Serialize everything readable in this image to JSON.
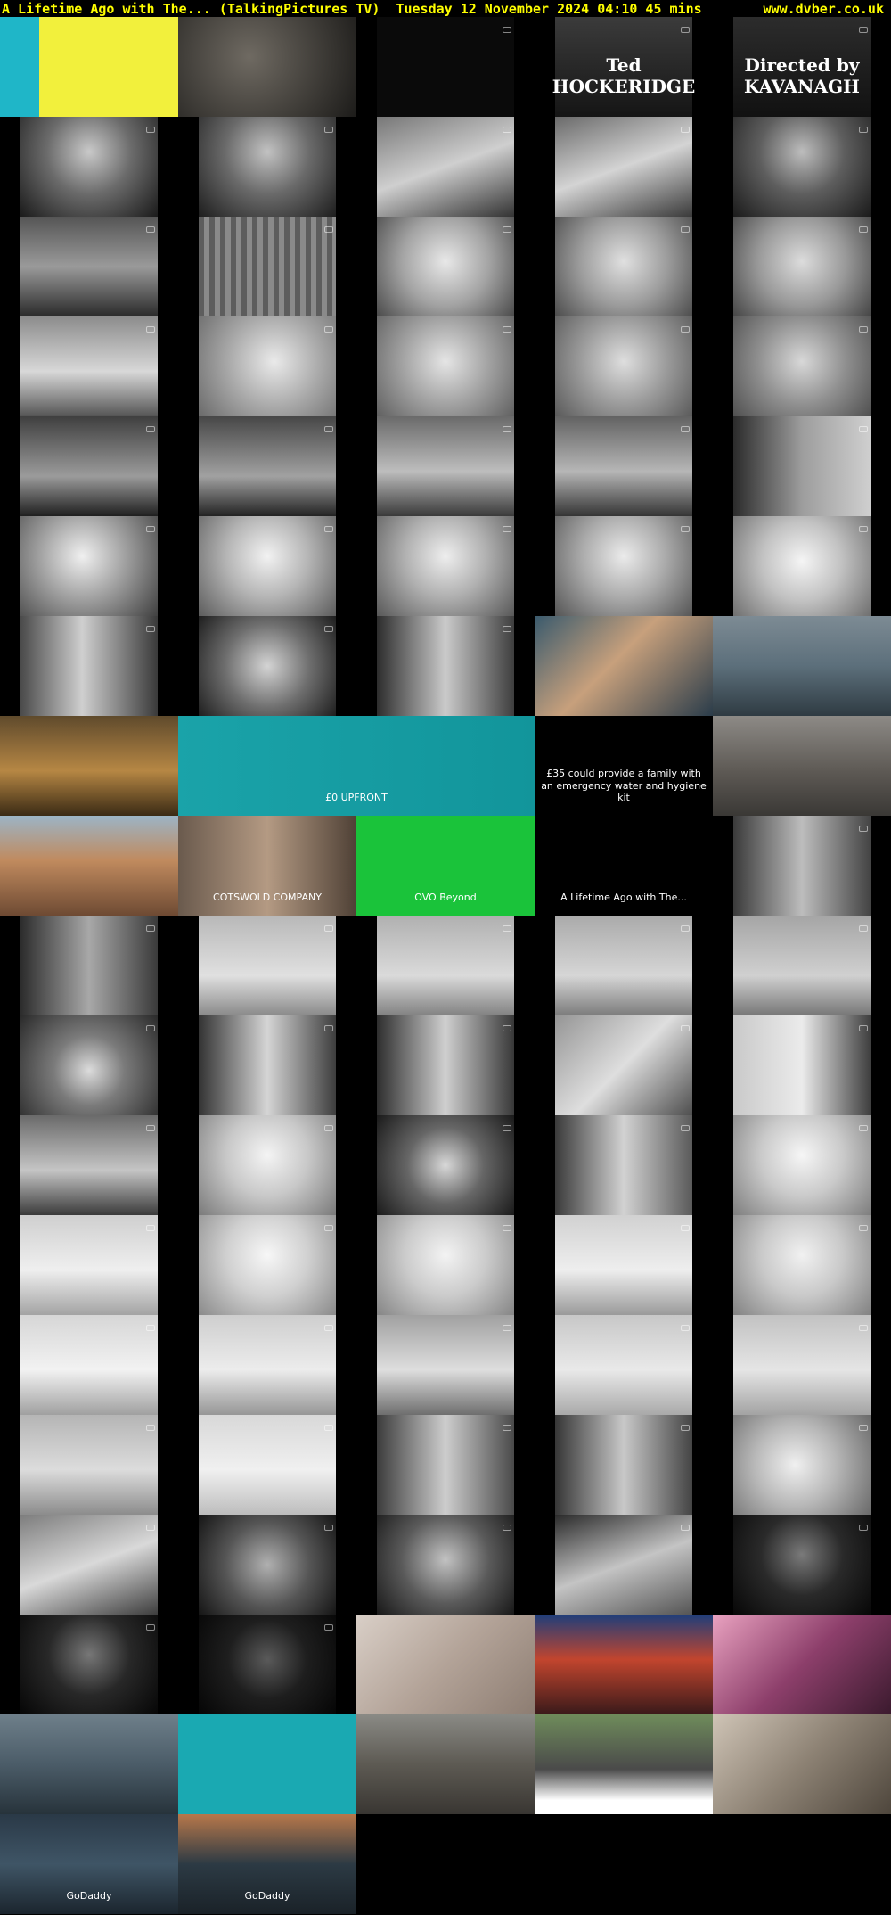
{
  "header": {
    "title": "A Lifetime Ago with The... (TalkingPictures TV)",
    "date": "Tuesday 12 November 2024",
    "time": "04:10",
    "duration": "45 mins",
    "site": "www.dvber.co.uk",
    "text_color": "#ffff00",
    "background": "#000000"
  },
  "rows": [
    [
      {
        "name": "thumb-advert-yellow",
        "kind": "colour",
        "bg": "linear-gradient(90deg,#1fb6c8 0%,#1fb6c8 22%,#f2f03c 22%,#f2f03c 100%)",
        "caption": ""
      },
      {
        "name": "thumb-dark-frame",
        "kind": "colour",
        "bg": "radial-gradient(circle at 40% 40%,#6f6a62,#1c1b19)",
        "caption": ""
      },
      {
        "name": "thumb-black-frame",
        "kind": "bw",
        "bg": "#0a0a0a",
        "caption": ""
      },
      {
        "name": "thumb-credit-hockeridge",
        "kind": "bw",
        "bg": "linear-gradient(180deg,#3b3b3b,#151515)",
        "caption": "Ted HOCKERIDGE",
        "big": true
      },
      {
        "name": "thumb-credit-kavanagh",
        "kind": "bw",
        "bg": "linear-gradient(180deg,#2c2c2c,#111)",
        "caption": "Directed by KAVANAGH",
        "big": true
      }
    ],
    [
      {
        "name": "thumb-man-portrait",
        "kind": "bw",
        "bg": "radial-gradient(circle at 50% 35%,#c9c9c9,#6b6b6b 45%,#1a1a1a)",
        "caption": ""
      },
      {
        "name": "thumb-man-portrait-2",
        "kind": "bw",
        "bg": "radial-gradient(circle at 50% 35%,#c2c2c2,#6a6a6a 45%,#1d1d1d)",
        "caption": ""
      },
      {
        "name": "thumb-piano-hands",
        "kind": "bw",
        "bg": "linear-gradient(160deg,#777,#cfcfcf 50%,#333)",
        "caption": ""
      },
      {
        "name": "thumb-piano-hands-2",
        "kind": "bw",
        "bg": "linear-gradient(160deg,#6a6a6a,#d4d4d4 50%,#3a3a3a)",
        "caption": ""
      },
      {
        "name": "thumb-man-portrait-3",
        "kind": "bw",
        "bg": "radial-gradient(circle at 50% 35%,#bdbdbd,#5e5e5e 45%,#1b1b1b)",
        "caption": ""
      }
    ],
    [
      {
        "name": "thumb-group-scene",
        "kind": "bw",
        "bg": "linear-gradient(180deg,#555,#9a9a9a 50%,#2a2a2a)",
        "caption": ""
      },
      {
        "name": "thumb-curtain",
        "kind": "bw",
        "bg": "repeating-linear-gradient(90deg,#5d5d5d 0 6px,#8a8a8a 6px 12px)",
        "caption": ""
      },
      {
        "name": "thumb-top-hat-singer",
        "kind": "bw",
        "bg": "radial-gradient(circle at 50% 45%,#e8e8e8,#a3a3a3 50%,#4a4a4a)",
        "caption": ""
      },
      {
        "name": "thumb-top-hat-singer-2",
        "kind": "bw",
        "bg": "radial-gradient(circle at 50% 45%,#e0e0e0,#9c9c9c 50%,#4c4c4c)",
        "caption": ""
      },
      {
        "name": "thumb-top-hat-singer-3",
        "kind": "bw",
        "bg": "radial-gradient(circle at 50% 45%,#dcdcdc,#999 50%,#454545)",
        "caption": ""
      }
    ],
    [
      {
        "name": "thumb-singer-wide",
        "kind": "bw",
        "bg": "linear-gradient(180deg,#8c8c8c,#d8d8d8 55%,#555)",
        "caption": ""
      },
      {
        "name": "thumb-singer-closeup",
        "kind": "bw",
        "bg": "radial-gradient(circle at 55% 45%,#eaeaea,#a8a8a8 50%,#6a6a6a)",
        "caption": ""
      },
      {
        "name": "thumb-singer-closeup-2",
        "kind": "bw",
        "bg": "radial-gradient(circle at 50% 45%,#e5e5e5,#a1a1a1 50%,#606060)",
        "caption": ""
      },
      {
        "name": "thumb-singer-closeup-3",
        "kind": "bw",
        "bg": "radial-gradient(circle at 50% 45%,#dedede,#9a9a9a 50%,#5a5a5a)",
        "caption": ""
      },
      {
        "name": "thumb-singer-closeup-4",
        "kind": "bw",
        "bg": "radial-gradient(circle at 50% 45%,#d8d8d8,#8f8f8f 50%,#505050)",
        "caption": ""
      }
    ],
    [
      {
        "name": "thumb-singer-stage",
        "kind": "bw",
        "bg": "linear-gradient(180deg,#3f3f3f,#9b9b9b 60%,#1f1f1f)",
        "caption": ""
      },
      {
        "name": "thumb-singer-stage-2",
        "kind": "bw",
        "bg": "linear-gradient(180deg,#474747,#a1a1a1 60%,#232323)",
        "caption": ""
      },
      {
        "name": "thumb-piano-stage",
        "kind": "bw",
        "bg": "linear-gradient(180deg,#6a6a6a,#bdbdbd 55%,#3a3a3a)",
        "caption": ""
      },
      {
        "name": "thumb-piano-stage-2",
        "kind": "bw",
        "bg": "linear-gradient(180deg,#626262,#b6b6b6 55%,#353535)",
        "caption": ""
      },
      {
        "name": "thumb-couple-curtain",
        "kind": "bw",
        "bg": "linear-gradient(90deg,#2b2b2b,#9d9d9d 50%,#cfcfcf)",
        "caption": ""
      }
    ],
    [
      {
        "name": "thumb-woman-profile",
        "kind": "bw",
        "bg": "radial-gradient(circle at 45% 40%,#f0f0f0,#a0a0a0 45%,#404040)",
        "caption": ""
      },
      {
        "name": "thumb-woman-portrait",
        "kind": "bw",
        "bg": "radial-gradient(circle at 50% 40%,#f2f2f2,#b5b5b5 45%,#5c5c5c)",
        "caption": ""
      },
      {
        "name": "thumb-woman-portrait-2",
        "kind": "bw",
        "bg": "radial-gradient(circle at 50% 40%,#eeeeee,#b0b0b0 45%,#585858)",
        "caption": ""
      },
      {
        "name": "thumb-woman-portrait-3",
        "kind": "bw",
        "bg": "radial-gradient(circle at 50% 40%,#ebebeb,#acacac 45%,#555)",
        "caption": ""
      },
      {
        "name": "thumb-woman-closeup",
        "kind": "bw",
        "bg": "radial-gradient(circle at 50% 45%,#f5f5f5,#c2c2c2 45%,#6f6f6f)",
        "caption": ""
      }
    ],
    [
      {
        "name": "thumb-couple",
        "kind": "bw",
        "bg": "linear-gradient(90deg,#4a4a4a,#cfcfcf 45%,#3a3a3a)",
        "caption": ""
      },
      {
        "name": "thumb-large-man",
        "kind": "bw",
        "bg": "radial-gradient(circle at 50% 50%,#d4d4d4,#6e6e6e 50%,#1e1e1e)",
        "caption": ""
      },
      {
        "name": "thumb-two-men",
        "kind": "bw",
        "bg": "linear-gradient(90deg,#2d2d2d,#cacaca 50%,#3e3e3e)",
        "caption": ""
      },
      {
        "name": "thumb-advert-young-man",
        "kind": "colour",
        "bg": "linear-gradient(135deg,#3a5a6d,#c7a07c 45%,#2a3c4a)",
        "caption": ""
      },
      {
        "name": "thumb-advert-boxer",
        "kind": "colour",
        "bg": "linear-gradient(180deg,#7d8b94,#5c6f7b 50%,#2f3b43)",
        "caption": ""
      }
    ],
    [
      {
        "name": "thumb-advert-lion",
        "kind": "colour",
        "bg": "linear-gradient(180deg,#5f4a2c,#b68744 55%,#3a2a14)",
        "caption": ""
      },
      {
        "name": "thumb-advert-ee-broadband",
        "kind": "colour",
        "bg": "linear-gradient(90deg,#1aa3a9,#12959b)",
        "caption": "£0 UPFRONT",
        "wide": true
      },
      {
        "name": "thumb-advert-appeal",
        "kind": "colour",
        "bg": "#000000",
        "caption": "£35 could provide a family with an emergency water and hygiene kit"
      },
      {
        "name": "thumb-advert-rubble",
        "kind": "colour",
        "bg": "linear-gradient(180deg,#8d8a86,#5e5a55 55%,#3a3835)",
        "caption": ""
      }
    ],
    [
      {
        "name": "thumb-advert-city",
        "kind": "colour",
        "bg": "linear-gradient(180deg,#9cb4c5,#c08a5e 45%,#6e4a33)",
        "caption": ""
      },
      {
        "name": "thumb-advert-cotswold",
        "kind": "colour",
        "bg": "linear-gradient(90deg,#6a5a4d,#b49a83 50%,#4f4136)",
        "caption": "COTSWOLD COMPANY"
      },
      {
        "name": "thumb-advert-ovo",
        "kind": "colour",
        "bg": "#1ac33a",
        "caption": "OVO Beyond"
      },
      {
        "name": "thumb-channel-ident",
        "kind": "colour",
        "bg": "#000000",
        "caption": "A Lifetime Ago with The..."
      },
      {
        "name": "thumb-couple-dance",
        "kind": "bw",
        "bg": "linear-gradient(90deg,#3a3a3a,#bdbdbd 50%,#444)",
        "caption": ""
      }
    ],
    [
      {
        "name": "thumb-couple-embrace",
        "kind": "bw",
        "bg": "linear-gradient(90deg,#2c2c2c,#a8a8a8 50%,#3a3a3a)",
        "caption": ""
      },
      {
        "name": "thumb-dancers",
        "kind": "bw",
        "bg": "linear-gradient(180deg,#b8b8b8,#e0e0e0 60%,#8a8a8a)",
        "caption": ""
      },
      {
        "name": "thumb-dancers-2",
        "kind": "bw",
        "bg": "linear-gradient(180deg,#b0b0b0,#dadada 60%,#828282)",
        "caption": ""
      },
      {
        "name": "thumb-dancers-3",
        "kind": "bw",
        "bg": "linear-gradient(180deg,#aaaaaa,#d6d6d6 60%,#7c7c7c)",
        "caption": ""
      },
      {
        "name": "thumb-dancers-4",
        "kind": "bw",
        "bg": "linear-gradient(180deg,#a5a5a5,#d0d0d0 60%,#777)",
        "caption": ""
      }
    ],
    [
      {
        "name": "thumb-crystal-ball",
        "kind": "bw",
        "bg": "radial-gradient(circle at 50% 55%,#dcdcdc,#7b7b7b 40%,#2a2a2a)",
        "caption": ""
      },
      {
        "name": "thumb-stage-trio",
        "kind": "bw",
        "bg": "linear-gradient(90deg,#333,#d5d5d5 50%,#3d3d3d)",
        "caption": ""
      },
      {
        "name": "thumb-stage-trio-2",
        "kind": "bw",
        "bg": "linear-gradient(90deg,#2e2e2e,#cfcfcf 50%,#383838)",
        "caption": ""
      },
      {
        "name": "thumb-pianist-woman",
        "kind": "bw",
        "bg": "linear-gradient(135deg,#959595,#dedede 50%,#4e4e4e)",
        "caption": ""
      },
      {
        "name": "thumb-violinist-woman",
        "kind": "bw",
        "bg": "linear-gradient(90deg,#c9c9c9,#ebebeb 50%,#3f3f3f)",
        "caption": ""
      }
    ],
    [
      {
        "name": "thumb-band",
        "kind": "bw",
        "bg": "linear-gradient(180deg,#6a6a6a,#c5c5c5 55%,#3b3b3b)",
        "caption": ""
      },
      {
        "name": "thumb-woman-singing",
        "kind": "bw",
        "bg": "radial-gradient(circle at 50% 40%,#f4f4f4,#c8c8c8 45%,#7a7a7a)",
        "caption": ""
      },
      {
        "name": "thumb-guitarist",
        "kind": "bw",
        "bg": "radial-gradient(circle at 50% 50%,#d8d8d8,#666 45%,#1a1a1a)",
        "caption": ""
      },
      {
        "name": "thumb-woman-with-band",
        "kind": "bw",
        "bg": "linear-gradient(90deg,#3a3a3a,#d2d2d2 50%,#5a5a5a)",
        "caption": ""
      },
      {
        "name": "thumb-woman-smiling",
        "kind": "bw",
        "bg": "radial-gradient(circle at 50% 40%,#f6f6f6,#cacaca 45%,#7e7e7e)",
        "caption": ""
      }
    ],
    [
      {
        "name": "thumb-explorer",
        "kind": "bw",
        "bg": "linear-gradient(180deg,#cfcfcf,#efefef 55%,#a3a3a3)",
        "caption": ""
      },
      {
        "name": "thumb-explorer-closeup",
        "kind": "bw",
        "bg": "radial-gradient(circle at 50% 40%,#f7f7f7,#d0d0d0 45%,#8a8a8a)",
        "caption": ""
      },
      {
        "name": "thumb-explorer-2",
        "kind": "bw",
        "bg": "radial-gradient(circle at 50% 40%,#f3f3f3,#cbcbcb 45%,#858585)",
        "caption": ""
      },
      {
        "name": "thumb-explorer-globe",
        "kind": "bw",
        "bg": "linear-gradient(180deg,#d1d1d1,#eeeeee 55%,#9a9a9a)",
        "caption": ""
      },
      {
        "name": "thumb-explorer-3",
        "kind": "bw",
        "bg": "radial-gradient(circle at 50% 40%,#f1f1f1,#c9c9c9 45%,#828282)",
        "caption": ""
      }
    ],
    [
      {
        "name": "thumb-explorer-4",
        "kind": "bw",
        "bg": "linear-gradient(180deg,#d6d6d6,#f2f2f2 55%,#a0a0a0)",
        "caption": ""
      },
      {
        "name": "thumb-explorer-globe-2",
        "kind": "bw",
        "bg": "linear-gradient(180deg,#cecece,#ececec 55%,#969696)",
        "caption": ""
      },
      {
        "name": "thumb-dancer-hula",
        "kind": "bw",
        "bg": "linear-gradient(180deg,#a0a0a0,#dedede 55%,#6e6e6e)",
        "caption": ""
      },
      {
        "name": "thumb-dancer-legs",
        "kind": "bw",
        "bg": "linear-gradient(180deg,#c7c7c7,#e9e9e9 55%,#a9a9a9)",
        "caption": ""
      },
      {
        "name": "thumb-dancer-legs-2",
        "kind": "bw",
        "bg": "linear-gradient(180deg,#c2c2c2,#e5e5e5 55%,#a3a3a3)",
        "caption": ""
      }
    ],
    [
      {
        "name": "thumb-dancers-stage",
        "kind": "bw",
        "bg": "linear-gradient(180deg,#b5b5b5,#dcdcdc 55%,#8c8c8c)",
        "caption": ""
      },
      {
        "name": "thumb-dancer-feet",
        "kind": "bw",
        "bg": "linear-gradient(180deg,#d8d8d8,#f0f0f0 55%,#bdbdbd)",
        "caption": ""
      },
      {
        "name": "thumb-handshake",
        "kind": "bw",
        "bg": "linear-gradient(90deg,#3c3c3c,#cdcdcd 50%,#4a4a4a)",
        "caption": ""
      },
      {
        "name": "thumb-three-men",
        "kind": "bw",
        "bg": "linear-gradient(90deg,#363636,#c8c8c8 50%,#444)",
        "caption": ""
      },
      {
        "name": "thumb-drum",
        "kind": "bw",
        "bg": "radial-gradient(circle at 45% 50%,#f0f0f0,#b8b8b8 45%,#6a6a6a)",
        "caption": ""
      }
    ],
    [
      {
        "name": "thumb-piano-keys",
        "kind": "bw",
        "bg": "linear-gradient(160deg,#7d7d7d,#d9d9d9 50%,#3d3d3d)",
        "caption": ""
      },
      {
        "name": "thumb-double-bass",
        "kind": "bw",
        "bg": "radial-gradient(circle at 50% 50%,#b0b0b0,#555 50%,#151515)",
        "caption": ""
      },
      {
        "name": "thumb-drummer",
        "kind": "bw",
        "bg": "radial-gradient(circle at 50% 45%,#c2c2c2,#5a5a5a 50%,#181818)",
        "caption": ""
      },
      {
        "name": "thumb-piano-keys-2",
        "kind": "bw",
        "bg": "linear-gradient(160deg,#2a2a2a,#c4c4c4 50%,#555)",
        "caption": ""
      },
      {
        "name": "thumb-man-dark",
        "kind": "bw",
        "bg": "radial-gradient(circle at 50% 40%,#7a7a7a,#2a2a2a 45%,#070707)",
        "caption": ""
      }
    ],
    [
      {
        "name": "thumb-man-dark-2",
        "kind": "bw",
        "bg": "radial-gradient(circle at 50% 40%,#777,#282828 45%,#060606)",
        "caption": ""
      },
      {
        "name": "thumb-man-stage-dark",
        "kind": "bw",
        "bg": "radial-gradient(circle at 50% 45%,#5a5a5a,#1e1e1e 45%,#050505)",
        "caption": ""
      },
      {
        "name": "thumb-advert-fabric",
        "kind": "colour",
        "bg": "linear-gradient(135deg,#d9cfc7,#b3a398 50%,#8d7d72)",
        "caption": ""
      },
      {
        "name": "thumb-advert-arcade",
        "kind": "colour",
        "bg": "linear-gradient(180deg,#1f3e7a,#c2452e 45%,#3a1a1a)",
        "caption": ""
      },
      {
        "name": "thumb-advert-phone",
        "kind": "colour",
        "bg": "linear-gradient(135deg,#e9a2c0,#8d3f6b 50%,#3b1a2e)",
        "caption": ""
      }
    ],
    [
      {
        "name": "thumb-advert-boxer-2",
        "kind": "colour",
        "bg": "linear-gradient(180deg,#6e7f8a,#4b5c68 50%,#27333b)",
        "caption": ""
      },
      {
        "name": "thumb-advert-teal",
        "kind": "colour",
        "bg": "#1aa9b2",
        "caption": ""
      },
      {
        "name": "thumb-advert-crowd",
        "kind": "colour",
        "bg": "linear-gradient(180deg,#8a8a85,#5d5a53 50%,#393632)",
        "caption": ""
      },
      {
        "name": "thumb-advert-coop-funeral",
        "kind": "colour",
        "bg": "linear-gradient(180deg,#6f8c5b,#4a4a4a 55%,#ffffff 86%,#ffffff)",
        "caption": ""
      },
      {
        "name": "thumb-advert-kitchen",
        "kind": "colour",
        "bg": "linear-gradient(135deg,#cfc4b6,#8d8274 50%,#4e463c)",
        "caption": ""
      }
    ],
    [
      {
        "name": "thumb-advert-godaddy",
        "kind": "colour",
        "bg": "linear-gradient(180deg,#2a3947,#3f5566 50%,#1b252e)",
        "caption": "GoDaddy"
      },
      {
        "name": "thumb-advert-godaddy-2",
        "kind": "colour",
        "bg": "linear-gradient(180deg,#b8784a,#2c3a44 50%,#1a2228)",
        "caption": "GoDaddy"
      }
    ]
  ]
}
